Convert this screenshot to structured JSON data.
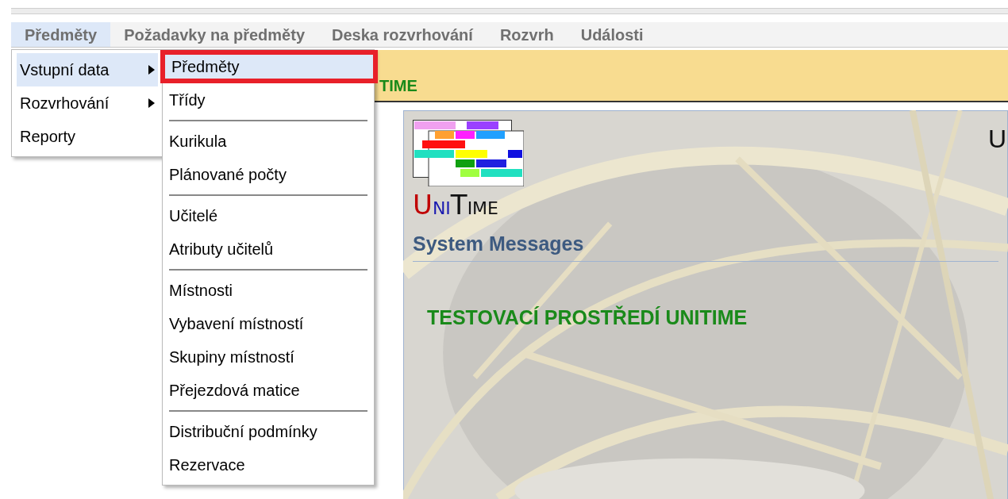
{
  "menubar": [
    {
      "label": "Předměty",
      "selected": true
    },
    {
      "label": "Požadavky na předměty",
      "selected": false
    },
    {
      "label": "Deska rozvrhování",
      "selected": false
    },
    {
      "label": "Rozvrh",
      "selected": false
    },
    {
      "label": "Události",
      "selected": false
    }
  ],
  "banner": {
    "text": "TIME"
  },
  "menu": [
    {
      "label": "Vstupní data",
      "submenu": true,
      "selected": true
    },
    {
      "label": "Rozvrhování",
      "submenu": true,
      "selected": false
    },
    {
      "label": "Reporty",
      "submenu": false,
      "selected": false
    }
  ],
  "submenu": [
    {
      "kind": "item",
      "label": "Předměty",
      "selected": true,
      "outlined": true
    },
    {
      "kind": "item",
      "label": "Třídy",
      "selected": false,
      "outlined": false
    },
    {
      "kind": "separator"
    },
    {
      "kind": "item",
      "label": "Kurikula",
      "selected": false,
      "outlined": false
    },
    {
      "kind": "item",
      "label": "Plánované počty",
      "selected": false,
      "outlined": false
    },
    {
      "kind": "separator"
    },
    {
      "kind": "item",
      "label": "Učitelé",
      "selected": false,
      "outlined": false
    },
    {
      "kind": "item",
      "label": "Atributy učitelů",
      "selected": false,
      "outlined": false
    },
    {
      "kind": "separator"
    },
    {
      "kind": "item",
      "label": "Místnosti",
      "selected": false,
      "outlined": false
    },
    {
      "kind": "item",
      "label": "Vybavení místností",
      "selected": false,
      "outlined": false
    },
    {
      "kind": "item",
      "label": "Skupiny místností",
      "selected": false,
      "outlined": false
    },
    {
      "kind": "item",
      "label": "Přejezdová matice",
      "selected": false,
      "outlined": false
    },
    {
      "kind": "separator"
    },
    {
      "kind": "item",
      "label": "Distribuční podmínky",
      "selected": false,
      "outlined": false
    },
    {
      "kind": "item",
      "label": "Rezervace",
      "selected": false,
      "outlined": false
    }
  ],
  "logo": {
    "letters": [
      {
        "text": "U",
        "color": "#c00000"
      },
      {
        "text": "NI",
        "color": "#1a1ab0"
      },
      {
        "text": "T",
        "color": "#111111"
      },
      {
        "text": "IME",
        "color": "#111111"
      }
    ]
  },
  "header_text": "U",
  "section_title": "System Messages",
  "message": "TESTOVACÍ PROSTŘEDÍ UNITIME"
}
